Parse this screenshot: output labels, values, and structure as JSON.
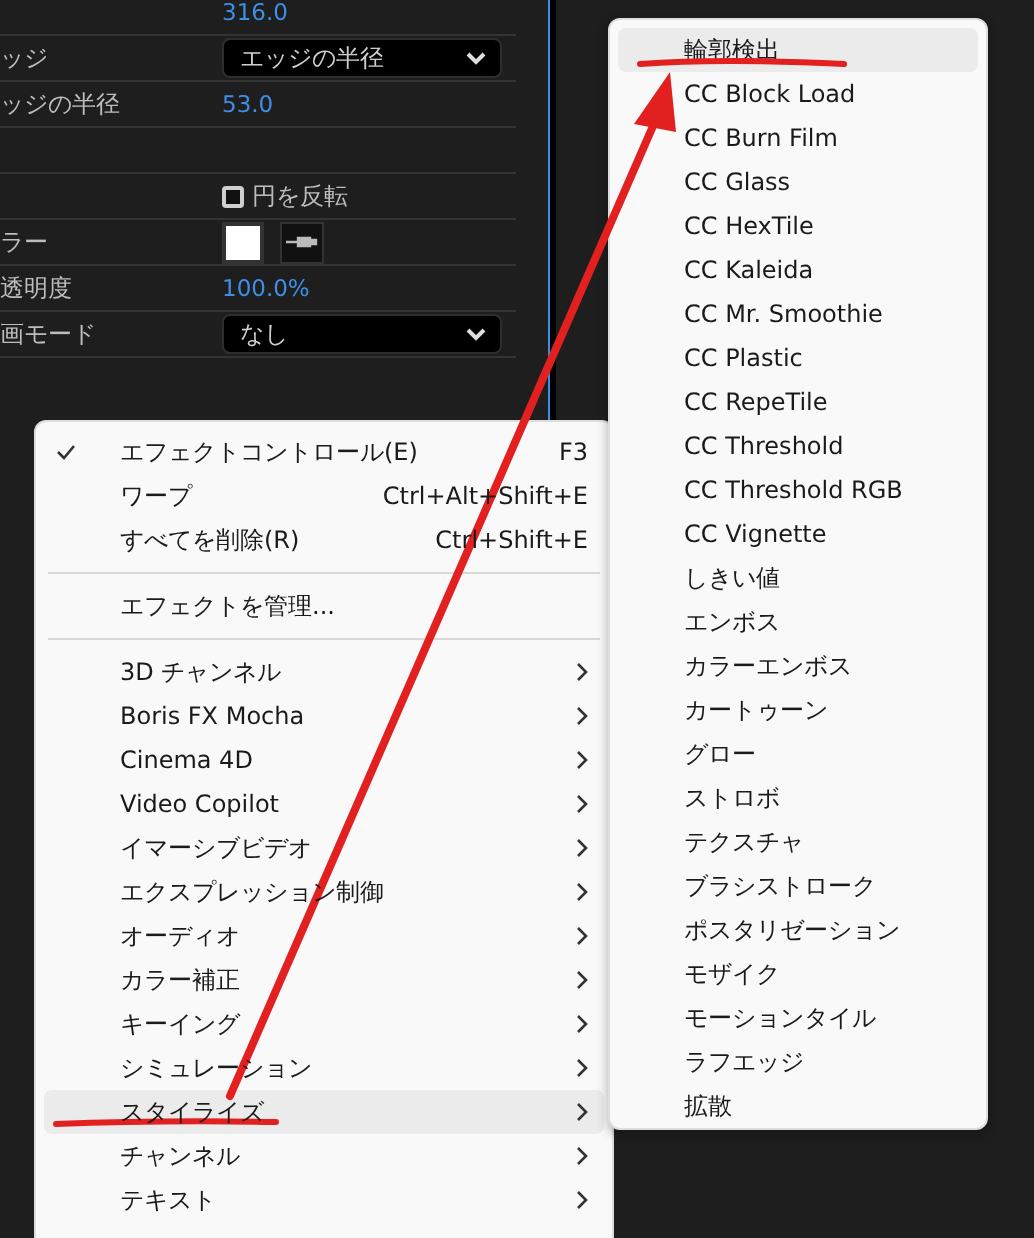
{
  "properties": [
    {
      "kind": "value",
      "value": "316.0"
    },
    {
      "kind": "dropdown",
      "label": "ッジ",
      "value": "エッジの半径"
    },
    {
      "kind": "value",
      "label": "ッジの半径",
      "value": "53.0"
    },
    {
      "kind": "empty"
    },
    {
      "kind": "checkbox",
      "text": "円を反転",
      "checked": false
    },
    {
      "kind": "color",
      "label": "ラー",
      "color": "#ffffff"
    },
    {
      "kind": "value",
      "label": "透明度",
      "value": "100.0%"
    },
    {
      "kind": "dropdown",
      "label": "画モード",
      "value": "なし"
    }
  ],
  "context_menu": [
    {
      "kind": "item",
      "label": "エフェクトコントロール(E)",
      "shortcut": "F3",
      "checked": true,
      "selected": false
    },
    {
      "kind": "item",
      "label": "ワープ",
      "shortcut": "Ctrl+Alt+Shift+E",
      "checked": false,
      "selected": false
    },
    {
      "kind": "item",
      "label": "すべてを削除(R)",
      "shortcut": "Ctrl+Shift+E",
      "checked": false,
      "selected": false
    },
    {
      "kind": "separator"
    },
    {
      "kind": "item",
      "label": "エフェクトを管理...",
      "checked": false,
      "selected": false
    },
    {
      "kind": "separator"
    },
    {
      "kind": "submenu",
      "label": "3D チャンネル",
      "selected": false
    },
    {
      "kind": "submenu",
      "label": "Boris FX Mocha",
      "selected": false
    },
    {
      "kind": "submenu",
      "label": "Cinema 4D",
      "selected": false
    },
    {
      "kind": "submenu",
      "label": "Video Copilot",
      "selected": false
    },
    {
      "kind": "submenu",
      "label": "イマーシブビデオ",
      "selected": false
    },
    {
      "kind": "submenu",
      "label": "エクスプレッション制御",
      "selected": false
    },
    {
      "kind": "submenu",
      "label": "オーディオ",
      "selected": false
    },
    {
      "kind": "submenu",
      "label": "カラー補正",
      "selected": false
    },
    {
      "kind": "submenu",
      "label": "キーイング",
      "selected": false
    },
    {
      "kind": "submenu",
      "label": "シミュレーション",
      "selected": false
    },
    {
      "kind": "submenu",
      "label": "スタイライズ",
      "selected": true
    },
    {
      "kind": "submenu",
      "label": "チャンネル",
      "selected": false
    },
    {
      "kind": "submenu",
      "label": "テキスト",
      "selected": false
    }
  ],
  "submenu": [
    {
      "label": "輪郭検出",
      "selected": true
    },
    {
      "label": "CC Block Load",
      "selected": false
    },
    {
      "label": "CC Burn Film",
      "selected": false
    },
    {
      "label": "CC Glass",
      "selected": false
    },
    {
      "label": "CC HexTile",
      "selected": false
    },
    {
      "label": "CC Kaleida",
      "selected": false
    },
    {
      "label": "CC Mr. Smoothie",
      "selected": false
    },
    {
      "label": "CC Plastic",
      "selected": false
    },
    {
      "label": "CC RepeTile",
      "selected": false
    },
    {
      "label": "CC Threshold",
      "selected": false
    },
    {
      "label": "CC Threshold RGB",
      "selected": false
    },
    {
      "label": "CC Vignette",
      "selected": false
    },
    {
      "label": "しきい値",
      "selected": false
    },
    {
      "label": "エンボス",
      "selected": false
    },
    {
      "label": "カラーエンボス",
      "selected": false
    },
    {
      "label": "カートゥーン",
      "selected": false
    },
    {
      "label": "グロー",
      "selected": false
    },
    {
      "label": "ストロボ",
      "selected": false
    },
    {
      "label": "テクスチャ",
      "selected": false
    },
    {
      "label": "ブラシストローク",
      "selected": false
    },
    {
      "label": "ポスタリゼーション",
      "selected": false
    },
    {
      "label": "モザイク",
      "selected": false
    },
    {
      "label": "モーションタイル",
      "selected": false
    },
    {
      "label": "ラフエッジ",
      "selected": false
    },
    {
      "label": "拡散",
      "selected": false
    }
  ]
}
